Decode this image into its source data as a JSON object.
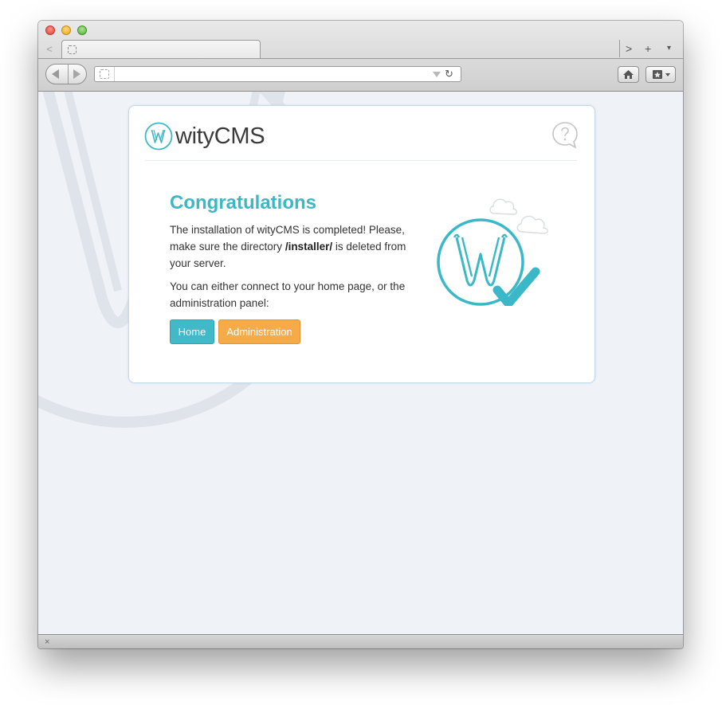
{
  "browser": {
    "tab_back_glyph": "<",
    "tab_forward_glyph": ">",
    "new_tab_glyph": "+",
    "tab_menu_glyph": "▾",
    "reload_glyph": "↻",
    "status_close_glyph": "×",
    "url_value": "",
    "url_placeholder": "",
    "icons": [
      "back-arrow-icon",
      "forward-arrow-icon",
      "home-icon",
      "bookmarks-icon",
      "reload-icon",
      "favicon-placeholder-icon"
    ]
  },
  "card": {
    "brand_name": "wityCMS",
    "title": "Congratulations",
    "message_line1": "The installation of wityCMS is completed! Please, make sure the directory ",
    "installer_path": "/installer/",
    "message_line1_end": " is deleted from your server.",
    "message_line2": "You can either connect to your home page, or the administration panel:",
    "home_button": "Home",
    "admin_button": "Administration",
    "help_icon": "help-bubble-icon"
  },
  "colors": {
    "accent_teal": "#3ab8c8",
    "home_button": "#42b9c8",
    "admin_button": "#f5ac48",
    "content_bg": "#eff3f8"
  }
}
